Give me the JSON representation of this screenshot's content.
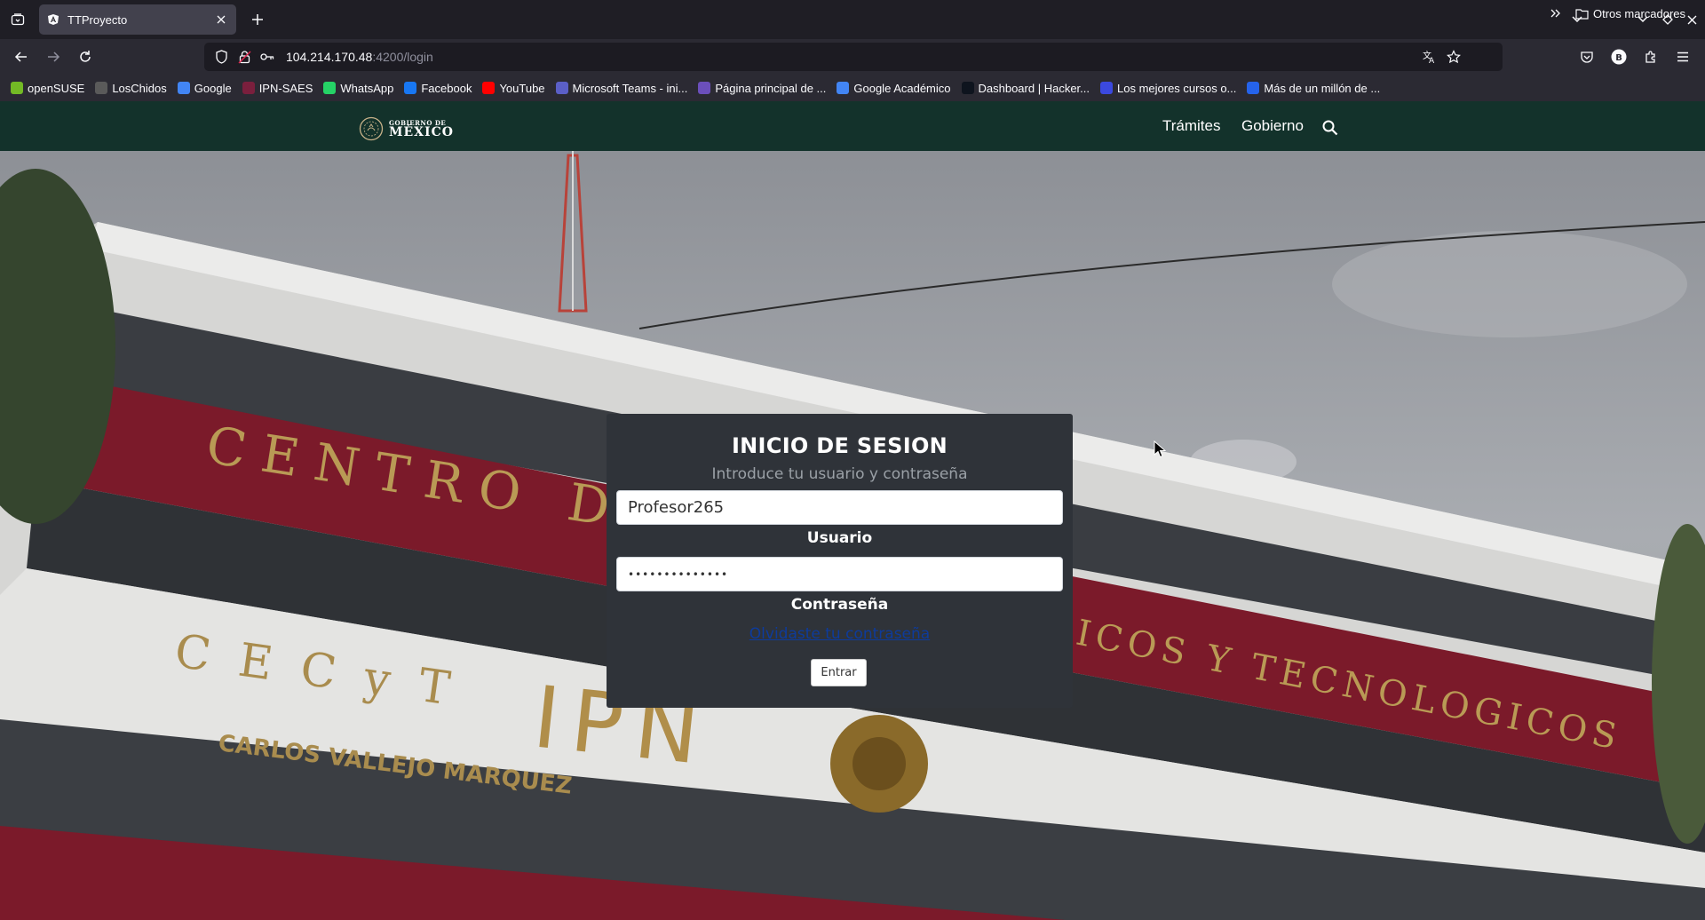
{
  "browser": {
    "tab": {
      "title": "TTProyecto"
    },
    "url": {
      "host": "104.214.170.48",
      "rest": ":4200/login"
    },
    "bookmarks": [
      {
        "label": "openSUSE",
        "color": "#73ba25"
      },
      {
        "label": "LosChidos",
        "color": "#5a5a5a"
      },
      {
        "label": "Google",
        "color": "#4285f4"
      },
      {
        "label": "IPN-SAES",
        "color": "#7a1f3d"
      },
      {
        "label": "WhatsApp",
        "color": "#25d366"
      },
      {
        "label": "Facebook",
        "color": "#1877f2"
      },
      {
        "label": "YouTube",
        "color": "#ff0000"
      },
      {
        "label": "Microsoft Teams - ini...",
        "color": "#5b5fc7"
      },
      {
        "label": "Página principal de ...",
        "color": "#6b4fbb"
      },
      {
        "label": "Google Académico",
        "color": "#4285f4"
      },
      {
        "label": "Dashboard | Hacker...",
        "color": "#0e141e"
      },
      {
        "label": "Los mejores cursos o...",
        "color": "#3b49df"
      },
      {
        "label": "Más de un millón de ...",
        "color": "#2563eb"
      }
    ],
    "other_bookmarks": "Otros marcadores",
    "profile_initial": "B"
  },
  "site": {
    "logo_small": "GOBIERNO DE",
    "logo_big": "MÉXICO",
    "nav": [
      "Trámites",
      "Gobierno"
    ]
  },
  "login": {
    "title": "INICIO DE SESION",
    "subtitle": "Introduce tu usuario y contraseña",
    "username_value": "Profesor265",
    "username_label": "Usuario",
    "password_mask": "••••••••••••••",
    "password_label": "Contraseña",
    "forgot_link": "Olvidaste tu contraseña",
    "submit": "Entrar"
  },
  "building_signs": {
    "top": "CENTRO DE",
    "right": "ICOS Y TECNOLOGICOS",
    "middle": "C E C y T",
    "ipn": "IPN",
    "name": "CARLOS VALLEJO MARQUEZ"
  },
  "colors": {
    "gob_green": "#13322b",
    "card_bg": "#2f3339",
    "building_red": "#7b1a2a"
  }
}
